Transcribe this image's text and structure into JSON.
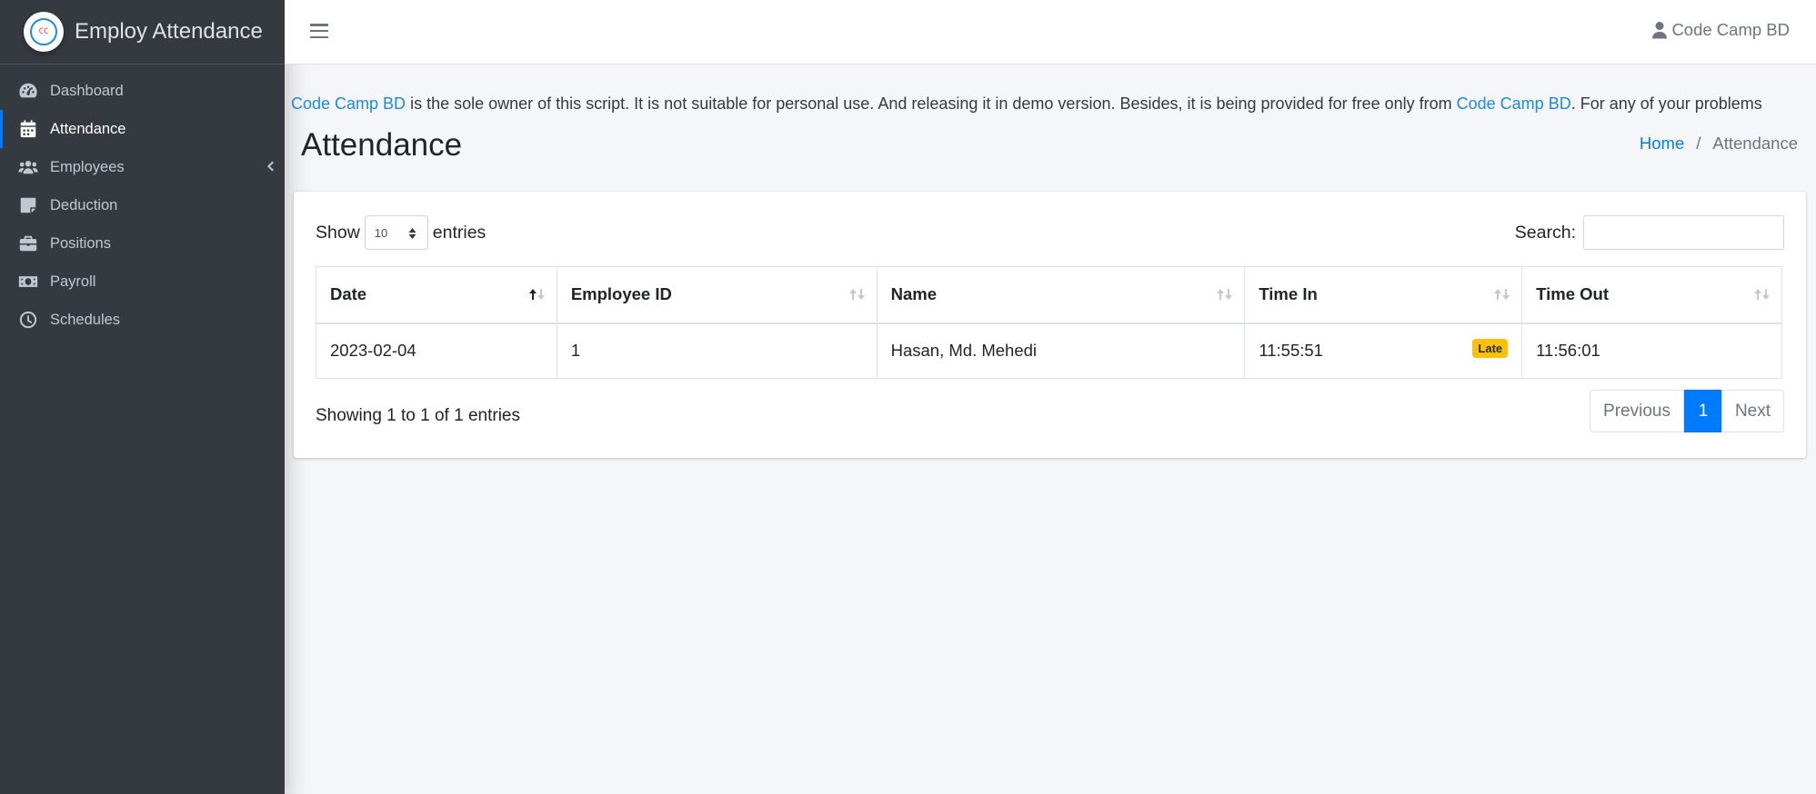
{
  "app": {
    "title": "Employ Attendance",
    "logo_text": "CC"
  },
  "sidebar": {
    "items": [
      {
        "label": "Dashboard",
        "icon": "tachometer-icon"
      },
      {
        "label": "Attendance",
        "icon": "calendar-icon",
        "active": true
      },
      {
        "label": "Employees",
        "icon": "users-icon",
        "has_arrow": true
      },
      {
        "label": "Deduction",
        "icon": "sticky-note-icon"
      },
      {
        "label": "Positions",
        "icon": "briefcase-icon"
      },
      {
        "label": "Payroll",
        "icon": "money-bill-icon"
      },
      {
        "label": "Schedules",
        "icon": "clock-icon"
      }
    ]
  },
  "topbar": {
    "user_name": "Code Camp BD"
  },
  "notice": {
    "link1": "Code Camp BD",
    "text1": " is the sole owner of this script. It is not suitable for personal use. And releasing it in demo version. Besides, it is being provided for free only from ",
    "link2": "Code Camp BD",
    "text2": ". For any of your problems"
  },
  "page": {
    "title": "Attendance",
    "breadcrumb": {
      "home": "Home",
      "separator": "/",
      "current": "Attendance"
    }
  },
  "table_controls": {
    "show_label": "Show",
    "entries_value": "10",
    "entries_label": "entries",
    "search_label": "Search:"
  },
  "table": {
    "headers": [
      "Date",
      "Employee ID",
      "Name",
      "Time In",
      "Time Out"
    ],
    "rows": [
      {
        "date": "2023-02-04",
        "employee_id": "1",
        "name": "Hasan, Md. Mehedi",
        "time_in": "11:55:51",
        "badge": "Late",
        "time_out": "11:56:01"
      }
    ]
  },
  "footer": {
    "info": "Showing 1 to 1 of 1 entries",
    "previous": "Previous",
    "current_page": "1",
    "next": "Next"
  },
  "colors": {
    "sidebar_bg": "#343a40",
    "primary": "#007bff",
    "link": "#1e88e5",
    "badge_warning": "#ffc107"
  }
}
